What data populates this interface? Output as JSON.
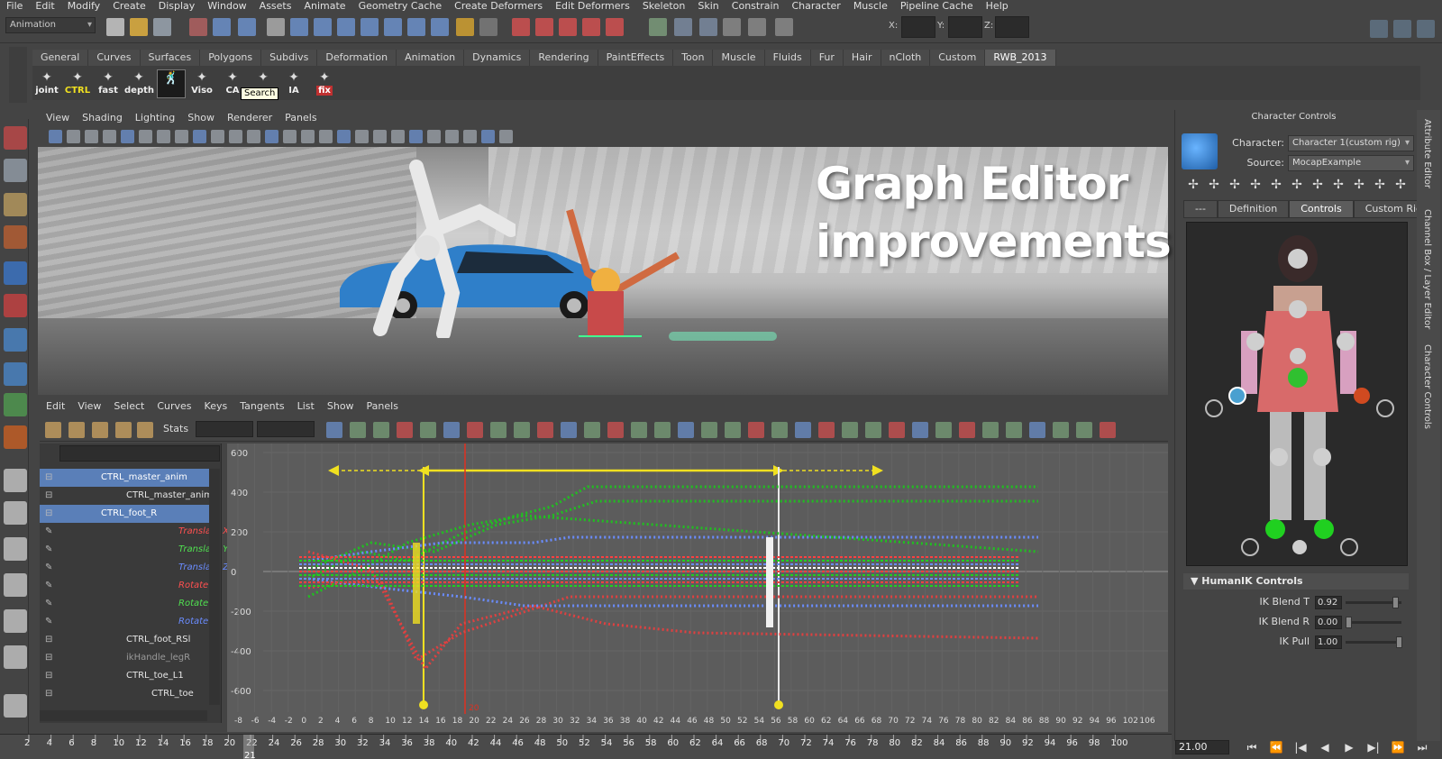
{
  "menubar": [
    "File",
    "Edit",
    "Modify",
    "Create",
    "Display",
    "Window",
    "Assets",
    "Animate",
    "Geometry Cache",
    "Create Deformers",
    "Edit Deformers",
    "Skeleton",
    "Skin",
    "Constrain",
    "Character",
    "Muscle",
    "Pipeline Cache",
    "Help"
  ],
  "toolbar": {
    "mode": "Animation",
    "x_label": "X:",
    "y_label": "Y:",
    "z_label": "Z:"
  },
  "shelf_tabs": [
    "General",
    "Curves",
    "Surfaces",
    "Polygons",
    "Subdivs",
    "Deformation",
    "Animation",
    "Dynamics",
    "Rendering",
    "PaintEffects",
    "Toon",
    "Muscle",
    "Fluids",
    "Fur",
    "Hair",
    "nCloth",
    "Custom",
    "RWB_2013"
  ],
  "shelf_buttons": [
    "joint",
    "CTRL",
    "fast",
    "depth",
    "",
    "Viso",
    "CA",
    "",
    "IA",
    "fix"
  ],
  "tooltip": "Search",
  "viewport_menu": [
    "View",
    "Shading",
    "Lighting",
    "Show",
    "Renderer",
    "Panels"
  ],
  "overlay": {
    "line1": "Graph Editor",
    "line2": "improvements"
  },
  "graph_editor": {
    "menu": [
      "Edit",
      "View",
      "Select",
      "Curves",
      "Keys",
      "Tangents",
      "List",
      "Show",
      "Panels"
    ],
    "stats_label": "Stats",
    "outliner": [
      {
        "label": "CTRL_master_anim",
        "selected": true,
        "indent": 0,
        "color": "#ffffff"
      },
      {
        "label": "CTRL_master_anim",
        "selected": false,
        "indent": 1,
        "color": "#e6e6e6"
      },
      {
        "label": "CTRL_foot_R",
        "selected": true,
        "indent": 0,
        "color": "#ffffff"
      },
      {
        "label": "Translate X",
        "selected": false,
        "indent": 2,
        "color": "#ff5050",
        "attr": true
      },
      {
        "label": "Translate Y",
        "selected": false,
        "indent": 2,
        "color": "#50e050",
        "attr": true
      },
      {
        "label": "Translate Z",
        "selected": false,
        "indent": 2,
        "color": "#6a8cff",
        "attr": true
      },
      {
        "label": "Rotate X",
        "selected": false,
        "indent": 2,
        "color": "#ff5050",
        "attr": true
      },
      {
        "label": "Rotate Y",
        "selected": false,
        "indent": 2,
        "color": "#50e050",
        "attr": true
      },
      {
        "label": "Rotate Z",
        "selected": false,
        "indent": 2,
        "color": "#6a8cff",
        "attr": true
      },
      {
        "label": "CTRL_foot_RSl",
        "selected": false,
        "indent": 1,
        "color": "#e6e6e6"
      },
      {
        "label": "ikHandle_legR",
        "selected": false,
        "indent": 1,
        "color": "#9a9a9a"
      },
      {
        "label": "CTRL_toe_L1",
        "selected": false,
        "indent": 1,
        "color": "#e6e6e6"
      },
      {
        "label": "CTRL_toe",
        "selected": false,
        "indent": 2,
        "color": "#e6e6e6"
      }
    ],
    "y_ticks": [
      "600",
      "400",
      "200",
      "0",
      "-200",
      "-400",
      "-600"
    ],
    "x_ticks": [
      "-8",
      "-6",
      "-4",
      "-2",
      "0",
      "2",
      "4",
      "6",
      "8",
      "10",
      "12",
      "14",
      "16",
      "18",
      "20",
      "22",
      "24",
      "26",
      "28",
      "30",
      "32",
      "34",
      "36",
      "38",
      "40",
      "42",
      "44",
      "46",
      "48",
      "50",
      "52",
      "54",
      "56",
      "58",
      "60",
      "62",
      "64",
      "66",
      "68",
      "70",
      "72",
      "74",
      "76",
      "78",
      "80",
      "82",
      "84",
      "86",
      "88",
      "90",
      "92",
      "94",
      "96",
      "102",
      "106"
    ],
    "marker_label": "20"
  },
  "character_controls": {
    "title": "Character Controls",
    "character_label": "Character:",
    "character_value": "Character 1(custom rig)",
    "source_label": "Source:",
    "source_value": "MocapExample",
    "tabs": [
      "---",
      "Definition",
      "Controls",
      "Custom Rig"
    ],
    "active_tab": "Controls",
    "humanik_header": "HumanIK Controls",
    "fields": [
      {
        "label": "IK Blend T",
        "value": "0.92",
        "level": 0.92
      },
      {
        "label": "IK Blend R",
        "value": "0.00",
        "level": 0.0
      },
      {
        "label": "IK Pull",
        "value": "1.00",
        "level": 1.0
      }
    ]
  },
  "side_tabs": [
    "Attribute Editor",
    "Channel Box / Layer Editor",
    "Character Controls"
  ],
  "timeline": {
    "ticks": [
      "2",
      "4",
      "6",
      "8",
      "10",
      "12",
      "14",
      "16",
      "18",
      "20",
      "22",
      "24",
      "26",
      "28",
      "30",
      "32",
      "34",
      "36",
      "38",
      "40",
      "42",
      "44",
      "46",
      "48",
      "50",
      "52",
      "54",
      "56",
      "58",
      "60",
      "62",
      "64",
      "66",
      "68",
      "70",
      "72",
      "74",
      "76",
      "78",
      "80",
      "82",
      "84",
      "86",
      "88",
      "90",
      "92",
      "94",
      "96",
      "98",
      "100"
    ],
    "current_marker": "21",
    "current_time": "21.00"
  },
  "colors": {
    "accent": "#5a7fb8",
    "range_yellow": "#f0e020",
    "current_red": "#e03020"
  }
}
